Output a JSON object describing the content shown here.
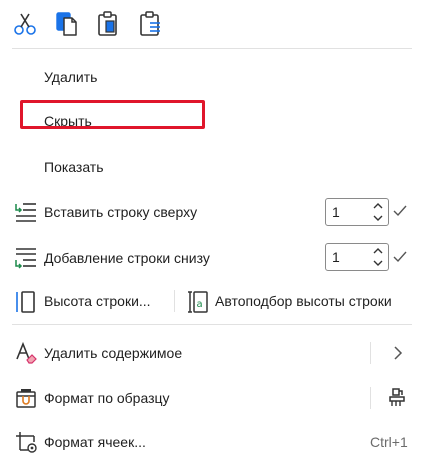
{
  "toolbar": {
    "buttons": [
      {
        "name": "cut",
        "icon": "scissors-icon"
      },
      {
        "name": "copy",
        "icon": "copy-icon"
      },
      {
        "name": "paste",
        "icon": "paste-icon"
      },
      {
        "name": "paste-special",
        "icon": "paste-special-icon"
      }
    ]
  },
  "menu": {
    "delete": "Удалить",
    "hide": "Скрыть",
    "show": "Показать",
    "insert_row_above": "Вставить строку сверху",
    "insert_row_above_count": "1",
    "add_row_below": "Добавление строки снизу",
    "add_row_below_count": "1",
    "row_height": "Высота строки...",
    "autofit_row_height": "Автоподбор высоты строки",
    "clear_contents": "Удалить содержимое",
    "format_painter": "Формат по образцу",
    "format_cells": "Формат ячеек...",
    "format_cells_shortcut": "Ctrl+1"
  },
  "colors": {
    "accent": "#1a73e8",
    "highlight_border": "#e0162b",
    "green_arrow": "#1b8a4a"
  }
}
